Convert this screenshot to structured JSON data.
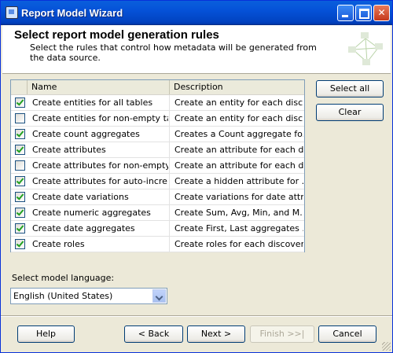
{
  "window": {
    "title": "Report Model Wizard"
  },
  "header": {
    "title": "Select report model generation rules",
    "subtitle": "Select the rules that control how metadata will be generated from the data source."
  },
  "grid": {
    "columns": [
      "",
      "Name",
      "Description"
    ],
    "rows": [
      {
        "checked": true,
        "name": "Create entities for all tables",
        "description": "Create an entity for each disc..."
      },
      {
        "checked": false,
        "name": "Create entities for non-empty ta...",
        "description": "Create an entity for each disc..."
      },
      {
        "checked": true,
        "name": "Create count aggregates",
        "description": "Creates a Count aggregate fo..."
      },
      {
        "checked": true,
        "name": "Create attributes",
        "description": "Create an attribute for each d..."
      },
      {
        "checked": false,
        "name": "Create attributes for non-empty...",
        "description": "Create an attribute for each d..."
      },
      {
        "checked": true,
        "name": "Create attributes for auto-incre...",
        "description": "Create a hidden attribute for ..."
      },
      {
        "checked": true,
        "name": "Create date variations",
        "description": "Create variations for date attr..."
      },
      {
        "checked": true,
        "name": "Create numeric aggregates",
        "description": "Create Sum, Avg, Min, and M..."
      },
      {
        "checked": true,
        "name": "Create date aggregates",
        "description": "Create First, Last aggregates ..."
      },
      {
        "checked": true,
        "name": "Create roles",
        "description": "Create roles for each discover..."
      }
    ]
  },
  "side_buttons": {
    "select_all": "Select all",
    "clear": "Clear"
  },
  "language": {
    "label": "Select model language:",
    "value": "English (United States)"
  },
  "footer": {
    "help": "Help",
    "back": "< Back",
    "next": "Next >",
    "finish": "Finish >>|",
    "cancel": "Cancel"
  }
}
